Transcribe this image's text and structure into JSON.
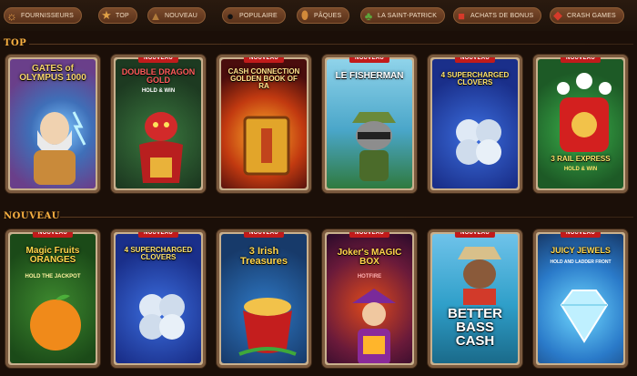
{
  "nav": [
    {
      "label": "FOURNISSEURS",
      "icon": "provider-icon",
      "glyph": "☼"
    },
    {
      "label": "TOP",
      "icon": "star-icon",
      "glyph": "★"
    },
    {
      "label": "NOUVEAU",
      "icon": "hat-icon",
      "glyph": "▲"
    },
    {
      "label": "POPULAIRE",
      "icon": "bomb-icon",
      "glyph": "●"
    },
    {
      "label": "PÂQUES",
      "icon": "egg-icon",
      "glyph": "⬮"
    },
    {
      "label": "LA SAINT-PATRICK",
      "icon": "clover-icon",
      "glyph": "♣"
    },
    {
      "label": "ACHATS DE BONUS",
      "icon": "gift-icon",
      "glyph": "■"
    },
    {
      "label": "CRASH GAMES",
      "icon": "crash-icon",
      "glyph": "◆"
    }
  ],
  "sections": {
    "top": "TOP",
    "nouveau": "NOUVEAU"
  },
  "badge": "NOUVEAU",
  "top_games": [
    {
      "title": "GATES of OLYMPUS 1000",
      "sub": ""
    },
    {
      "title": "DOUBLE DRAGON GOLD",
      "sub": "HOLD & WIN"
    },
    {
      "title": "CASH CONNECTION GOLDEN BOOK OF RA",
      "sub": ""
    },
    {
      "title": "LE FISHERMAN",
      "sub": ""
    },
    {
      "title": "4 SUPERCHARGED CLOVERS",
      "sub": ""
    },
    {
      "title": "3 RAIL EXPRESS",
      "sub": "HOLD & WIN"
    }
  ],
  "new_games": [
    {
      "title": "Magic Fruits ORANGES",
      "sub": "HOLD THE JACKPOT"
    },
    {
      "title": "4 SUPERCHARGED CLOVERS",
      "sub": ""
    },
    {
      "title": "3 Irish Treasures",
      "sub": ""
    },
    {
      "title": "Joker's MAGIC BOX",
      "sub": "HOTFIRE"
    },
    {
      "title": "BETTER BASS CASH",
      "sub": ""
    },
    {
      "title": "JUICY JEWELS",
      "sub": "HOLD AND LADDER FRONT"
    }
  ]
}
